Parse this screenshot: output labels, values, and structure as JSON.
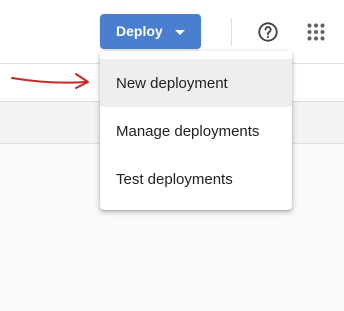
{
  "toolbar": {
    "deploy_label": "Deploy",
    "deploy_caret_icon": "caret-down-icon",
    "help_icon": "help-circle-icon",
    "apps_icon": "apps-grid-icon"
  },
  "deploy_menu": {
    "items": [
      {
        "label": "New deployment",
        "active": true
      },
      {
        "label": "Manage deployments",
        "active": false
      },
      {
        "label": "Test deployments",
        "active": false
      }
    ]
  },
  "annotation": {
    "arrow_icon": "red-arrow-icon",
    "color": "#c62828"
  },
  "colors": {
    "accent": "#4a7fcf",
    "menu_hover": "#eeeeee"
  }
}
